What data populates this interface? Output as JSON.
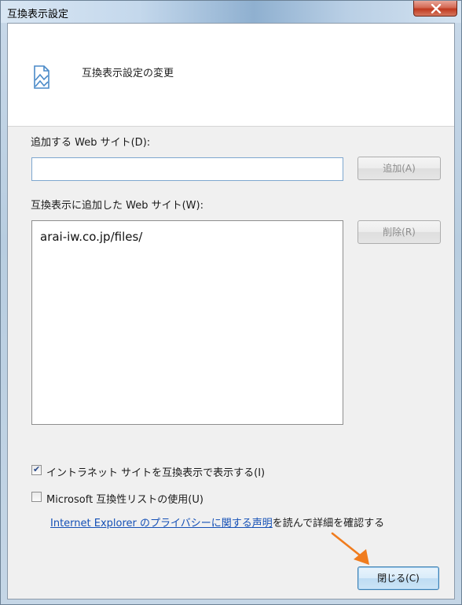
{
  "window": {
    "title": "互換表示設定",
    "close_glyph": "✕"
  },
  "header": {
    "text": "互換表示設定の変更",
    "icon": "compat-view-icon"
  },
  "add_site": {
    "label": "追加する Web サイト(D):",
    "input_value": "",
    "button_label": "追加(A)"
  },
  "sites_list": {
    "label": "互換表示に追加した Web サイト(W):",
    "items": [
      "arai-iw.co.jp/files/"
    ],
    "remove_button_label": "削除(R)"
  },
  "options": {
    "intranet": {
      "label": "イントラネット サイトを互換表示で表示する(I)",
      "checked": true
    },
    "microsoft_list": {
      "label": "Microsoft 互換性リストの使用(U)",
      "checked": false
    }
  },
  "privacy": {
    "link_text": "Internet Explorer のプライバシーに関する声明",
    "trailing_text": "を読んで詳細を確認する"
  },
  "footer": {
    "close_label": "閉じる(C)"
  },
  "colors": {
    "link": "#1450b6",
    "arrow": "#f07c1e",
    "close_button_border": "#3c7fb1"
  }
}
